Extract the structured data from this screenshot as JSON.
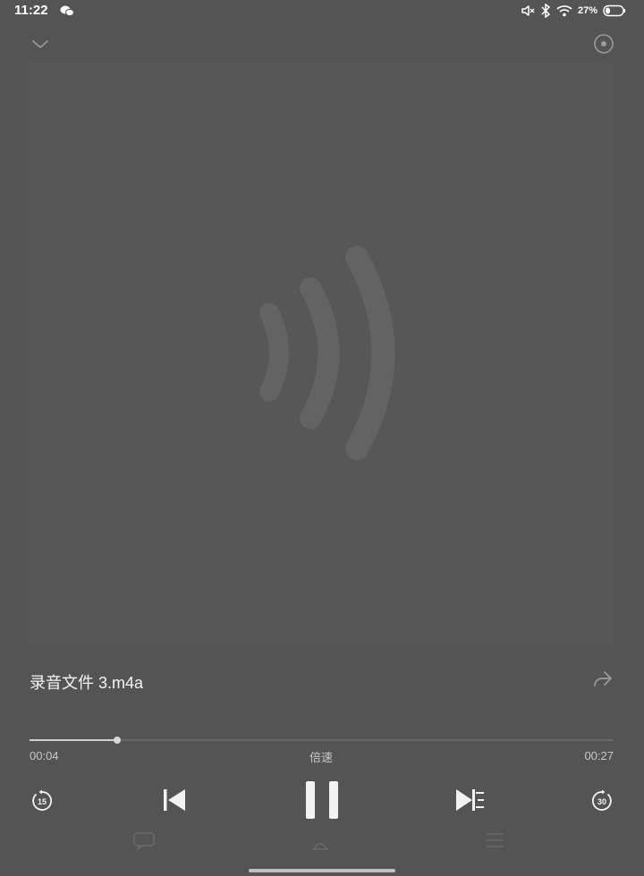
{
  "status_bar": {
    "time": "11:22",
    "battery_percent": "27%",
    "icons": [
      "wechat-icon",
      "mute-icon",
      "bluetooth-icon",
      "wifi-icon",
      "battery-icon"
    ]
  },
  "player": {
    "file_name": "录音文件 3.m4a",
    "elapsed": "00:04",
    "total": "00:27",
    "progress_fraction": 0.15,
    "speed_label": "倍速",
    "replay_back_seconds": "15",
    "skip_forward_seconds": "30"
  },
  "colors": {
    "background": "#545454",
    "artwork_background": "#575757",
    "artwork_glyph": "#636363",
    "progress_fill": "#cfcfcf",
    "controls": "#f2f2f2"
  }
}
